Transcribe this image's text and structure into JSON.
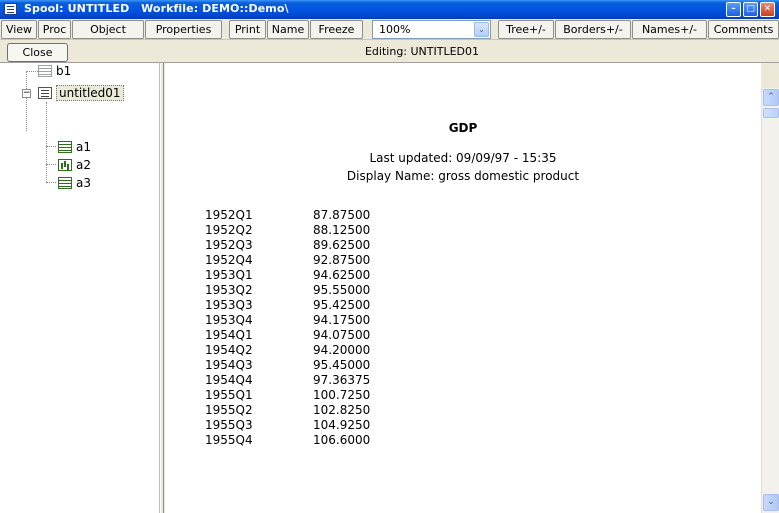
{
  "window": {
    "title": "Spool: UNTITLED   Workfile: DEMO::Demo\\",
    "minimize_glyph": "–",
    "maximize_glyph": "□",
    "close_glyph": "✕"
  },
  "toolbar": {
    "buttons": [
      "View",
      "Proc",
      "Object",
      "Properties",
      "Print",
      "Name",
      "Freeze",
      "Tree+/-",
      "Borders+/-",
      "Names+/-",
      "Comments"
    ],
    "zoom_value": "100%",
    "zoom_dropdown_glyph": "⌄"
  },
  "editbar": {
    "close_label": "Close",
    "editing_label": "Editing: UNTITLED01"
  },
  "tree": {
    "items": [
      {
        "label": "b1",
        "icon": "table-icon"
      },
      {
        "label": "untitled01",
        "icon": "text-icon"
      },
      {
        "label": "a1",
        "icon": "table-icon"
      },
      {
        "label": "a2",
        "icon": "graph-icon"
      },
      {
        "label": "a3",
        "icon": "table-icon"
      }
    ],
    "expander_glyph": "−"
  },
  "document": {
    "title": "GDP",
    "updated": "Last updated: 09/09/97 - 15:35",
    "display_name": "Display Name: gross domestic product",
    "rows": [
      {
        "period": "1952Q1",
        "value": "87.87500"
      },
      {
        "period": "1952Q2",
        "value": "88.12500"
      },
      {
        "period": "1952Q3",
        "value": "89.62500"
      },
      {
        "period": "1952Q4",
        "value": "92.87500"
      },
      {
        "period": "1953Q1",
        "value": "94.62500"
      },
      {
        "period": "1953Q2",
        "value": "95.55000"
      },
      {
        "period": "1953Q3",
        "value": "95.42500"
      },
      {
        "period": "1953Q4",
        "value": "94.17500"
      },
      {
        "period": "1954Q1",
        "value": "94.07500"
      },
      {
        "period": "1954Q2",
        "value": "94.20000"
      },
      {
        "period": "1954Q3",
        "value": "95.45000"
      },
      {
        "period": "1954Q4",
        "value": "97.36375"
      },
      {
        "period": "1955Q1",
        "value": "100.7250"
      },
      {
        "period": "1955Q2",
        "value": "102.8250"
      },
      {
        "period": "1955Q3",
        "value": "104.9250"
      },
      {
        "period": "1955Q4",
        "value": "106.6000"
      }
    ]
  },
  "scrollbar": {
    "up_glyph": "⌃",
    "down_glyph": "⌄"
  }
}
